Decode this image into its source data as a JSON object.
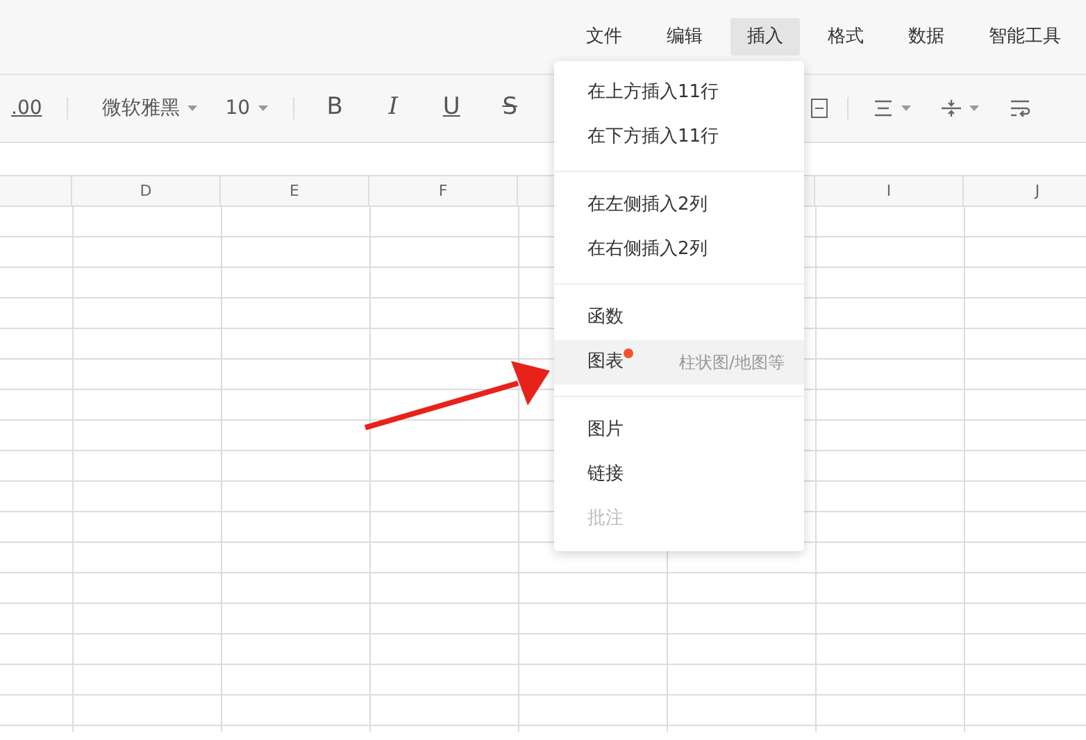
{
  "menu_bar": [
    {
      "label": "文件",
      "selected": false
    },
    {
      "label": "编辑",
      "selected": false
    },
    {
      "label": "插入",
      "selected": true
    },
    {
      "label": "格式",
      "selected": false
    },
    {
      "label": "数据",
      "selected": false
    },
    {
      "label": "智能工具",
      "selected": false
    }
  ],
  "toolbar": {
    "decimal_label": ".00",
    "font_name": "微软雅黑",
    "font_size": "10",
    "format_buttons": [
      {
        "label": "B",
        "kind": "bold"
      },
      {
        "label": "I",
        "kind": "italic"
      },
      {
        "label": "U",
        "kind": "underline"
      },
      {
        "label": "S",
        "kind": "strike"
      }
    ]
  },
  "column_headers": [
    "D",
    "E",
    "F",
    "I",
    "J"
  ],
  "insert_menu": [
    {
      "kind": "item",
      "label": "在上方插入11行",
      "selected": false,
      "disabled": false
    },
    {
      "kind": "item",
      "label": "在下方插入11行",
      "selected": false,
      "disabled": false
    },
    {
      "kind": "divider"
    },
    {
      "kind": "item",
      "label": "在左侧插入2列",
      "selected": false,
      "disabled": false
    },
    {
      "kind": "item",
      "label": "在右侧插入2列",
      "selected": false,
      "disabled": false
    },
    {
      "kind": "divider"
    },
    {
      "kind": "item",
      "label": "函数",
      "selected": false,
      "disabled": false
    },
    {
      "kind": "item",
      "label": "图表",
      "hint": "柱状图/地图等",
      "new_dot": true,
      "selected": true,
      "disabled": false
    },
    {
      "kind": "divider"
    },
    {
      "kind": "item",
      "label": "图片",
      "selected": false,
      "disabled": false
    },
    {
      "kind": "item",
      "label": "链接",
      "selected": false,
      "disabled": false
    },
    {
      "kind": "item",
      "label": "批注",
      "selected": false,
      "disabled": true
    }
  ]
}
